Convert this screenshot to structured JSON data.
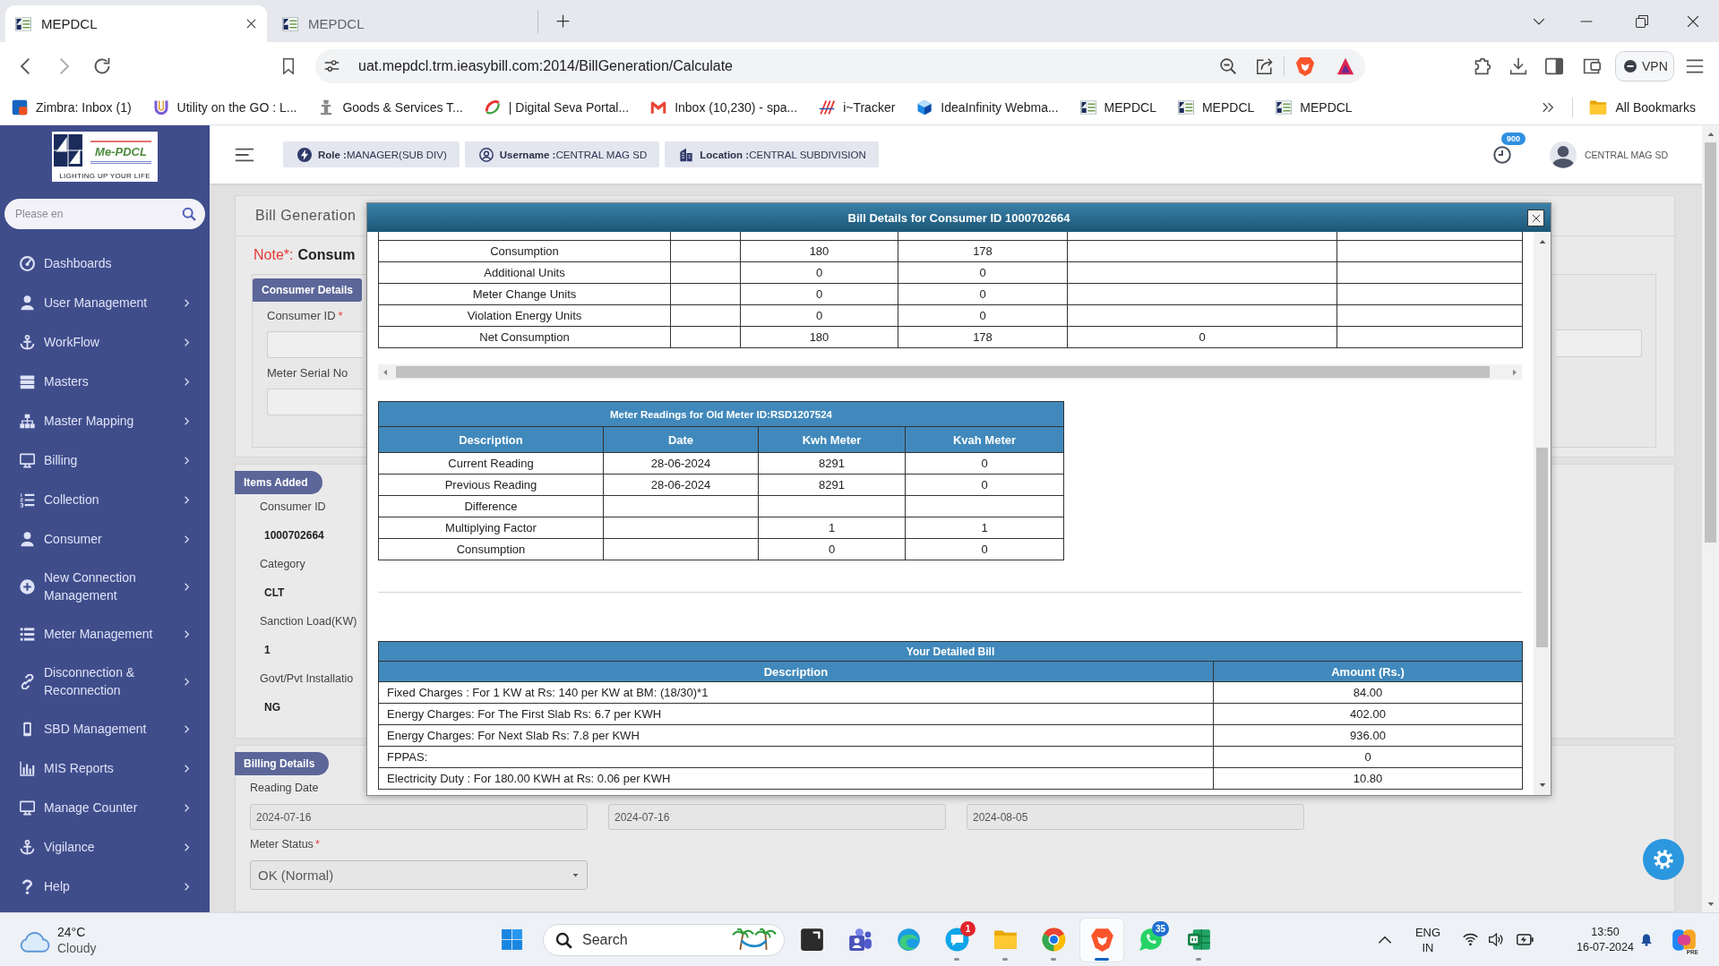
{
  "browser": {
    "tabs": [
      {
        "title": "MEPDCL",
        "selected": true
      },
      {
        "title": "MEPDCL",
        "selected": false
      }
    ],
    "address": "uat.mepdcl.trm.ieasybill.com:2014/BillGeneration/Calculate",
    "vpn": "VPN",
    "bookmarks": [
      {
        "label": "Zimbra: Inbox (1)"
      },
      {
        "label": "Utility on the GO : L..."
      },
      {
        "label": "Goods & Services T..."
      },
      {
        "label": "| Digital Seva Portal..."
      },
      {
        "label": "Inbox (10,230) - spa..."
      },
      {
        "label": "i~Tracker"
      },
      {
        "label": "IdeaInfinity Webma..."
      },
      {
        "label": "MEPDCL"
      },
      {
        "label": "MEPDCL"
      },
      {
        "label": "MEPDCL"
      }
    ],
    "all_bookmarks": "All Bookmarks"
  },
  "sidebar": {
    "logo": {
      "name": "Me-PDCL",
      "tagline": "LIGHTING UP YOUR LIFE"
    },
    "search": {
      "placeholder": "Please en"
    },
    "items": [
      {
        "label": "Dashboards",
        "submenu": false
      },
      {
        "label": "User Management",
        "submenu": true
      },
      {
        "label": "WorkFlow",
        "submenu": true
      },
      {
        "label": "Masters",
        "submenu": true
      },
      {
        "label": "Master Mapping",
        "submenu": true
      },
      {
        "label": "Billing",
        "submenu": true
      },
      {
        "label": "Collection",
        "submenu": true
      },
      {
        "label": "Consumer",
        "submenu": true
      },
      {
        "label": "New Connection Management",
        "submenu": true
      },
      {
        "label": "Meter Management",
        "submenu": true
      },
      {
        "label": "Disconnection & Reconnection",
        "submenu": true
      },
      {
        "label": "SBD Management",
        "submenu": true
      },
      {
        "label": "MIS Reports",
        "submenu": true
      },
      {
        "label": "Manage Counter",
        "submenu": true
      },
      {
        "label": "Vigilance",
        "submenu": true
      },
      {
        "label": "Help",
        "submenu": true
      }
    ]
  },
  "header": {
    "chips": [
      {
        "text": "**Role :**MANAGER(SUB DIV)"
      },
      {
        "text": "**Username :**CENTRAL MAG SD"
      },
      {
        "text": "**Location :**CENTRAL SUBDIVISION"
      }
    ],
    "notifications": "900",
    "user": "CENTRAL MAG SD"
  },
  "bill_generation": {
    "title": "Bill Generation",
    "note": {
      "label": "Note*:",
      "text": "Consum"
    },
    "consumer_details": {
      "tab": "Consumer Details",
      "fields": [
        {
          "label": "Consumer ID",
          "required_mark": "*"
        },
        {
          "label": "Meter Serial No"
        }
      ]
    }
  },
  "items_added": {
    "tab": "Items Added",
    "fields": [
      {
        "label": "Consumer ID",
        "value": "1000702664"
      },
      {
        "label": "Category",
        "value": "CLT"
      },
      {
        "label": "Sanction Load(KW)",
        "value": "1"
      },
      {
        "label": "Govt/Pvt Installatio",
        "value": "NG"
      }
    ]
  },
  "billing_details": {
    "tab": "Billing Details",
    "reading_date_label": "Reading Date",
    "dates": [
      "2024-07-16",
      "2024-07-16",
      "2024-08-05"
    ],
    "meter_status": {
      "label": "Meter Status",
      "required_mark": "*",
      "value": "OK (Normal)"
    }
  },
  "modal": {
    "title": "Bill Details for Consumer ID 1000702664",
    "consumption_table": {
      "rows": [
        {
          "column_1": "Consumption",
          "column_3": "180",
          "column_4": "178"
        },
        {
          "column_1": "Additional Units",
          "column_3": "0",
          "column_4": "0"
        },
        {
          "column_1": "Meter Change Units",
          "column_3": "0",
          "column_4": "0"
        },
        {
          "column_1": "Violation Energy Units",
          "column_3": "0",
          "column_4": "0"
        },
        {
          "column_1": "Net Consumption",
          "column_3": "180",
          "column_4": "178",
          "column_5": "0"
        }
      ]
    },
    "meter_readings": {
      "title": "Meter Readings for Old Meter ID:RSD1207524",
      "columns": [
        "Description",
        "Date",
        "Kwh Meter",
        "Kvah Meter"
      ],
      "rows": [
        {
          "description": "Current Reading",
          "date": "28-06-2024",
          "kwh_meter": "8291",
          "kvah_meter": "0"
        },
        {
          "description": "Previous Reading",
          "date": "28-06-2024",
          "kwh_meter": "8291",
          "kvah_meter": "0"
        },
        {
          "description": "Difference"
        },
        {
          "description": "Multiplying Factor",
          "kwh_meter": "1",
          "kvah_meter": "1"
        },
        {
          "description": "Consumption",
          "kwh_meter": "0",
          "kvah_meter": "0"
        }
      ]
    },
    "detailed_bill": {
      "title": "Your Detailed Bill",
      "columns": [
        "Description",
        "Amount (Rs.)"
      ],
      "rows": [
        {
          "description": "Fixed Charges : For 1 KW at Rs: 140 per KW at BM: (18/30)*1",
          "amount": "84.00"
        },
        {
          "description": "Energy Charges: For The First Slab Rs: 6.7 per KWH",
          "amount": "402.00"
        },
        {
          "description": "Energy Charges: For Next Slab Rs: 7.8 per KWH",
          "amount": "936.00"
        },
        {
          "description": "FPPAS:",
          "amount": "0"
        },
        {
          "description": "Electricity Duty : For 180.00 KWH at Rs: 0.06 per KWH",
          "amount": "10.80"
        }
      ]
    }
  },
  "taskbar": {
    "weather": {
      "temperature": "24°C",
      "condition": "Cloudy"
    },
    "search": {
      "placeholder": "Search"
    },
    "apps": [
      {
        "selected": false,
        "running": false
      },
      {
        "selected": false,
        "running": false
      },
      {
        "selected": false,
        "running": false
      },
      {
        "selected": false,
        "running": true,
        "badge": "1",
        "color": "#e3242b"
      },
      {
        "selected": false,
        "running": true
      },
      {
        "selected": false,
        "running": true
      },
      {
        "selected": true,
        "running": true
      },
      {
        "selected": false,
        "running": false,
        "badge": "35",
        "color": "#1f6fd1"
      },
      {
        "selected": false,
        "running": true
      }
    ],
    "tray": {
      "language": "ENG",
      "region": "IN",
      "time": "13:50",
      "date": "16-07-2024",
      "tag": "PRE"
    }
  }
}
